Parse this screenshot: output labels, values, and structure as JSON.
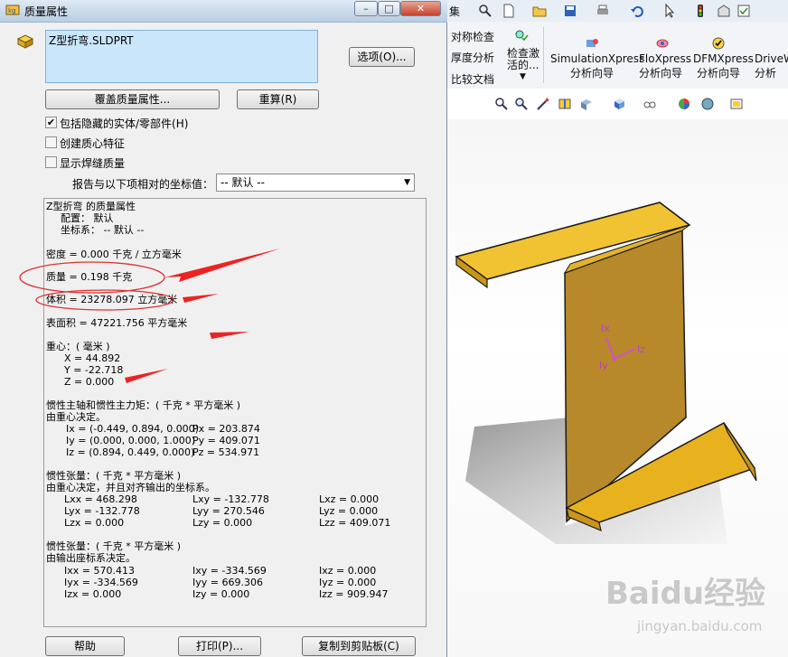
{
  "dialog": {
    "title": "质量属性",
    "selected_item": "Z型折弯.SLDPRT",
    "options_button": "选项(O)...",
    "override_button": "覆盖质量属性...",
    "recalc_button": "重算(R)",
    "checkboxes": [
      {
        "label": "包括隐藏的实体/零部件(H)",
        "checked": true
      },
      {
        "label": "创建质心特征",
        "checked": false
      },
      {
        "label": "显示焊缝质量",
        "checked": false
      }
    ],
    "report_label": "报告与以下项相对的坐标值：",
    "coord_select": "-- 默认 --",
    "help_button": "帮助",
    "print_button": "打印(P)...",
    "copy_button": "复制到剪贴板(C)"
  },
  "results": {
    "header": "Z型折弯 的质量属性",
    "config": "配置： 默认",
    "coord": "坐标系： -- 默认 --",
    "density": "密度 = 0.000 千克 / 立方毫米",
    "mass": "质量 = 0.198 千克",
    "volume": "体积 = 23278.097 立方毫米",
    "surface": "表面积 = 47221.756  平方毫米",
    "cog_title": "重心：( 毫米 )",
    "cog_x": "X = 44.892",
    "cog_y": "Y = -22.718",
    "cog_z": "Z = 0.000",
    "principal_title": "惯性主轴和惯性主力矩：( 千克 *  平方毫米 )",
    "principal_sub": "由重心决定。",
    "ix": "Ix = (-0.449, 0.894, 0.000)",
    "iy": "Iy = (0.000, 0.000, 1.000)",
    "iz": "Iz = (0.894, 0.449, 0.000)",
    "px": "Px = 203.874",
    "py": "Py = 409.071",
    "pz": "Pz = 534.971",
    "tensor1_title": "惯性张量：( 千克 *  平方毫米 )",
    "tensor1_sub": "由重心决定，并且对齐输出的坐标系。",
    "t1": [
      [
        "Lxx = 468.298",
        "Lxy = -132.778",
        "Lxz = 0.000"
      ],
      [
        "Lyx = -132.778",
        "Lyy = 270.546",
        "Lyz = 0.000"
      ],
      [
        "Lzx = 0.000",
        "Lzy = 0.000",
        "Lzz = 409.071"
      ]
    ],
    "tensor2_title": "惯性张量：( 千克 *  平方毫米 )",
    "tensor2_sub": "由输出座标系决定。",
    "t2": [
      [
        "Ixx = 570.413",
        "Ixy = -334.569",
        "Ixz = 0.000"
      ],
      [
        "Iyx = -334.569",
        "Iyy = 669.306",
        "Iyz = 0.000"
      ],
      [
        "Izx = 0.000",
        "Izy = 0.000",
        "Izz = 909.947"
      ]
    ]
  },
  "solidworks": {
    "menu_fragment": "集",
    "ribbon": {
      "symmetry_check": "对称检查",
      "thickness": "厚度分析",
      "compare": "比较文档",
      "check_active_1": "检查激",
      "check_active_2": "活的...",
      "simulation_1": "SimulationXpress",
      "simulation_2": "分析向导",
      "floxpress_1": "FloXpress",
      "floxpress_2": "分析向导",
      "dfmxpress_1": "DFMXpress",
      "dfmxpress_2": "分析向导",
      "drive_1": "DriveW",
      "drive_2": "分析"
    },
    "triad": {
      "x": "Ix",
      "y": "Iy",
      "z": "Iz"
    },
    "part_color": "#e8b21f",
    "watermark_main": "Baidu经验",
    "watermark_sub": "jingyan.baidu.com"
  }
}
